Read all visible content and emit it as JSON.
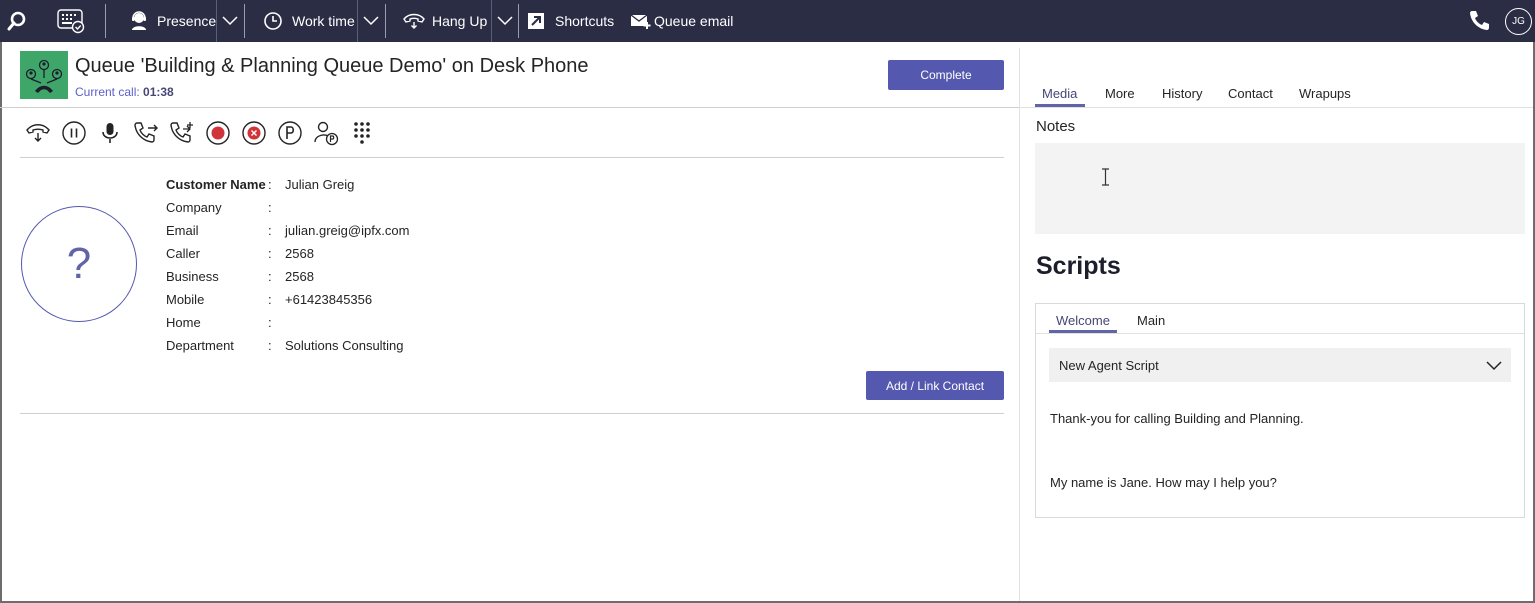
{
  "topbar": {
    "presence_label": "Presence",
    "worktime_label": "Work time",
    "hangup_label": "Hang Up",
    "shortcuts_label": "Shortcuts",
    "queue_email_label": "Queue email",
    "user_initials": "JG"
  },
  "call": {
    "title": "Queue 'Building & Planning Queue Demo' on Desk Phone",
    "current_call_label": "Current call:",
    "current_call_time": "01:38",
    "complete_label": "Complete"
  },
  "contact": {
    "avatar_placeholder": "?",
    "fields": [
      {
        "label": "Customer Name",
        "value": "Julian Greig"
      },
      {
        "label": "Company",
        "value": ""
      },
      {
        "label": "Email",
        "value": "julian.greig@ipfx.com"
      },
      {
        "label": "Caller",
        "value": "2568"
      },
      {
        "label": "Business",
        "value": "2568"
      },
      {
        "label": "Mobile",
        "value": "+61423845356"
      },
      {
        "label": "Home",
        "value": ""
      },
      {
        "label": "Department",
        "value": "Solutions Consulting"
      }
    ],
    "separator": ":",
    "add_link_label": "Add / Link Contact"
  },
  "right_tabs": [
    "Media",
    "More",
    "History",
    "Contact",
    "Wrapups"
  ],
  "notes": {
    "label": "Notes",
    "value": ""
  },
  "scripts": {
    "title": "Scripts",
    "tabs": [
      "Welcome",
      "Main"
    ],
    "selected_script": "New Agent Script",
    "lines": [
      "Thank-you for calling Building and Planning.",
      "My name is Jane. How may I help you?"
    ]
  },
  "colors": {
    "topbar": "#2b2d45",
    "accent": "#5558af",
    "queue_logo": "#3fa66a"
  }
}
